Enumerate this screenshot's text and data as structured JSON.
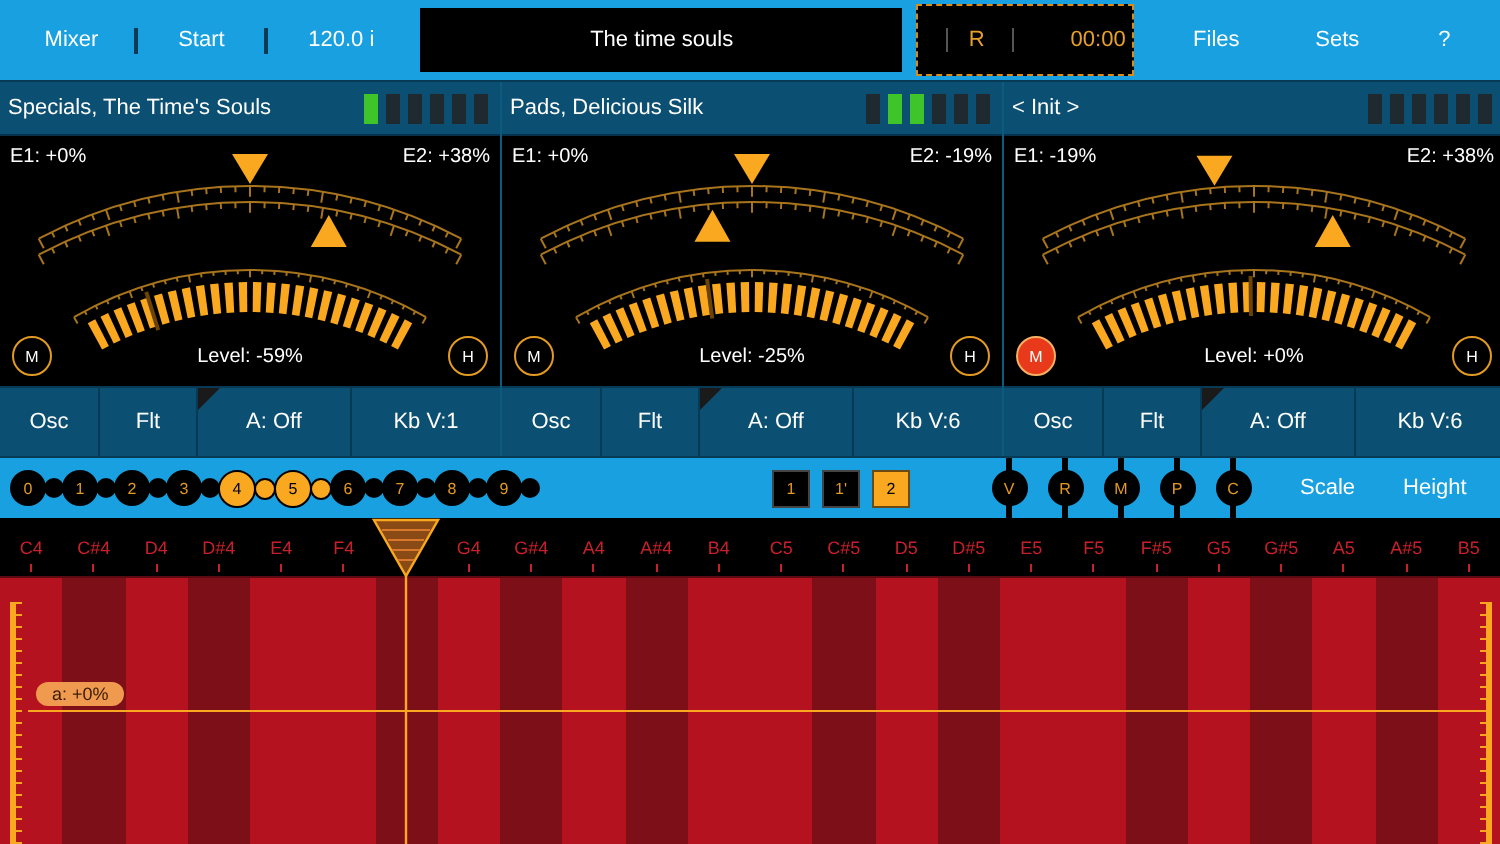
{
  "top_bar": {
    "mixer": "Mixer",
    "start": "Start",
    "tempo": "120.0 i",
    "song_title": "The time souls",
    "record": "R",
    "time": "00:00",
    "files": "Files",
    "sets": "Sets",
    "help": "?"
  },
  "panels": [
    {
      "title": "Specials, The Time's Souls",
      "meter": [
        {
          "lit": true
        },
        {
          "lit": false
        },
        {
          "lit": false
        },
        {
          "lit": false
        },
        {
          "lit": false
        },
        {
          "lit": false
        }
      ],
      "e1": "E1: +0%",
      "e2": "E2: +38%",
      "e1_pointer": {
        "level": 0.5
      },
      "e2_pointer": {
        "level": 0.68
      },
      "level_marker": {
        "level": 0.2
      },
      "level_text": "Level: -59%",
      "mute": {
        "label": "M",
        "on": false
      },
      "hold": "H",
      "buttons": [
        {
          "label": "Osc",
          "corner": false
        },
        {
          "label": "Flt",
          "corner": false
        },
        {
          "label": "A: Off",
          "corner": true
        },
        {
          "label": "Kb V:1",
          "corner": false
        }
      ]
    },
    {
      "title": "Pads, Delicious Silk",
      "meter": [
        {
          "lit": false
        },
        {
          "lit": true
        },
        {
          "lit": true
        },
        {
          "lit": false
        },
        {
          "lit": false
        },
        {
          "lit": false
        }
      ],
      "e1": "E1: +0%",
      "e2": "E2: -19%",
      "e1_pointer": {
        "level": 0.5
      },
      "e2_pointer": {
        "level": 0.41
      },
      "level_marker": {
        "level": 0.37
      },
      "level_text": "Level: -25%",
      "mute": {
        "label": "M",
        "on": false
      },
      "hold": "H",
      "buttons": [
        {
          "label": "Osc",
          "corner": false
        },
        {
          "label": "Flt",
          "corner": false
        },
        {
          "label": "A: Off",
          "corner": true
        },
        {
          "label": "Kb V:6",
          "corner": false
        }
      ]
    },
    {
      "title": "< Init >",
      "meter": [
        {
          "lit": false
        },
        {
          "lit": false
        },
        {
          "lit": false
        },
        {
          "lit": false
        },
        {
          "lit": false
        },
        {
          "lit": false
        }
      ],
      "e1": "E1: -19%",
      "e2": "E2: +38%",
      "e1_pointer": {
        "level": 0.41
      },
      "e2_pointer": {
        "level": 0.68
      },
      "level_marker": {
        "level": 0.49
      },
      "level_text": "Level: +0%",
      "mute": {
        "label": "M",
        "on": true
      },
      "hold": "H",
      "buttons": [
        {
          "label": "Osc",
          "corner": false
        },
        {
          "label": "Flt",
          "corner": false
        },
        {
          "label": "A: Off",
          "corner": true
        },
        {
          "label": "Kb V:6",
          "corner": false
        }
      ]
    }
  ],
  "octaves": [
    {
      "label": "0",
      "selected": false
    },
    {
      "label": "1",
      "selected": false
    },
    {
      "label": "2",
      "selected": false
    },
    {
      "label": "3",
      "selected": false
    },
    {
      "label": "4",
      "selected": true
    },
    {
      "label": "5",
      "selected": true
    },
    {
      "label": "6",
      "selected": false
    },
    {
      "label": "7",
      "selected": false
    },
    {
      "label": "8",
      "selected": false
    },
    {
      "label": "9",
      "selected": false
    }
  ],
  "layers": [
    {
      "label": "1",
      "selected": false
    },
    {
      "label": "1'",
      "selected": false
    },
    {
      "label": "2",
      "selected": true
    }
  ],
  "modes": [
    "V",
    "R",
    "M",
    "P",
    "C"
  ],
  "scale": "Scale",
  "height": "Height",
  "keyboard": {
    "keys": [
      {
        "label": "C4",
        "sharp": false,
        "selected": false
      },
      {
        "label": "C#4",
        "sharp": true,
        "selected": false
      },
      {
        "label": "D4",
        "sharp": false,
        "selected": false
      },
      {
        "label": "D#4",
        "sharp": true,
        "selected": false
      },
      {
        "label": "E4",
        "sharp": false,
        "selected": false
      },
      {
        "label": "F4",
        "sharp": false,
        "selected": false
      },
      {
        "sharp": true,
        "selected": true
      },
      {
        "label": "G4",
        "sharp": false,
        "selected": false
      },
      {
        "label": "G#4",
        "sharp": true,
        "selected": false
      },
      {
        "label": "A4",
        "sharp": false,
        "selected": false
      },
      {
        "label": "A#4",
        "sharp": true,
        "selected": false
      },
      {
        "label": "B4",
        "sharp": false,
        "selected": false
      },
      {
        "label": "C5",
        "sharp": false,
        "selected": false
      },
      {
        "label": "C#5",
        "sharp": true,
        "selected": false
      },
      {
        "label": "D5",
        "sharp": false,
        "selected": false
      },
      {
        "label": "D#5",
        "sharp": true,
        "selected": false
      },
      {
        "label": "E5",
        "sharp": false,
        "selected": false
      },
      {
        "label": "F5",
        "sharp": false,
        "selected": false
      },
      {
        "label": "F#5",
        "sharp": true,
        "selected": false
      },
      {
        "label": "G5",
        "sharp": false,
        "selected": false
      },
      {
        "label": "G#5",
        "sharp": true,
        "selected": false
      },
      {
        "label": "A5",
        "sharp": false,
        "selected": false
      },
      {
        "label": "A#5",
        "sharp": true,
        "selected": false
      },
      {
        "label": "B5",
        "sharp": false,
        "selected": false
      }
    ],
    "pitch_badge": "a: +0%"
  }
}
